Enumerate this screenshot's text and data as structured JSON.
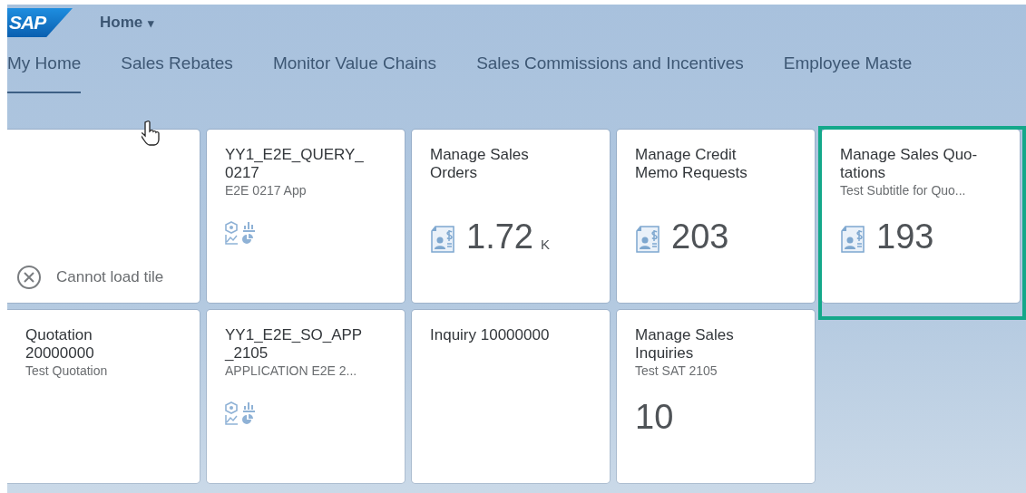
{
  "header": {
    "logo": "SAP",
    "title": "Home",
    "caret": "▾"
  },
  "tabs": [
    {
      "label": "My Home",
      "selected": true
    },
    {
      "label": "Sales Rebates",
      "selected": false
    },
    {
      "label": "Monitor Value Chains",
      "selected": false
    },
    {
      "label": "Sales Commissions and Incentives",
      "selected": false
    },
    {
      "label": "Employee Maste",
      "selected": false
    }
  ],
  "tiles": [
    {
      "kind": "error",
      "message": "Cannot load tile",
      "highlighted": false
    },
    {
      "kind": "charts",
      "title": "YY1_E2E_QUERY_\n0217",
      "subtitle": "E2E 0217 App",
      "highlighted": false
    },
    {
      "kind": "kpi",
      "title": "Manage Sales\nOrders",
      "value": "1.72",
      "unit": "K",
      "highlighted": false
    },
    {
      "kind": "kpi",
      "title": "Manage Credit\nMemo Requests",
      "value": "203",
      "highlighted": false
    },
    {
      "kind": "kpi",
      "title": "Manage Sales Quo-\ntations",
      "subtitle": "Test Subtitle for Quo...",
      "value": "193",
      "highlighted": true
    },
    {
      "kind": "plain",
      "title": "Quotation\n20000000",
      "subtitle": "Test Quotation",
      "highlighted": false
    },
    {
      "kind": "charts",
      "title": "YY1_E2E_SO_APP\n_2105",
      "subtitle": "APPLICATION E2E 2...",
      "highlighted": false
    },
    {
      "kind": "plain",
      "title": "Inquiry 10000000",
      "highlighted": false
    },
    {
      "kind": "number",
      "title": "Manage Sales\nInquiries",
      "subtitle": "Test SAT 2105",
      "value": "10",
      "highlighted": false
    }
  ]
}
